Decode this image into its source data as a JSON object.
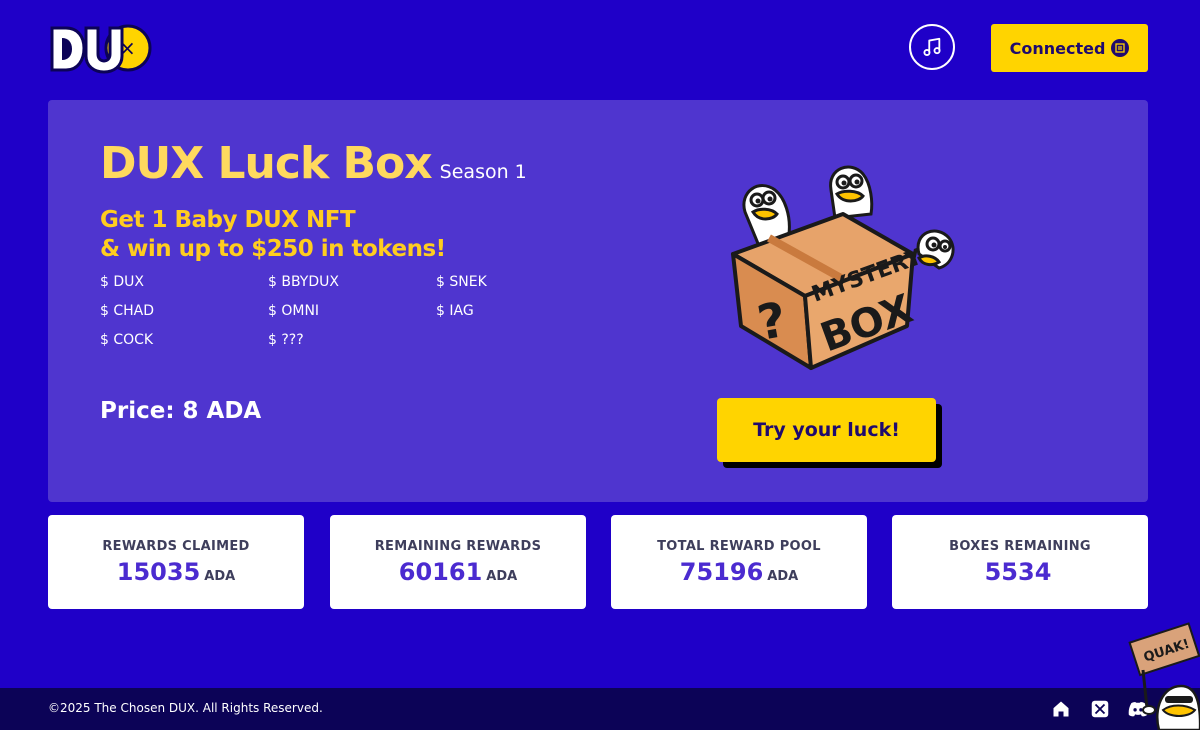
{
  "header": {
    "logo_text": "DUX",
    "connect_label": "Connected",
    "music_icon": "music-note-icon",
    "wallet_icon": "wallet-icon"
  },
  "hero": {
    "title": "DUX Luck Box",
    "season": "Season 1",
    "promo_line1": "Get 1 Baby DUX NFT",
    "promo_line2": "& win up to $250 in tokens!",
    "tokens": [
      "$ DUX",
      "$ BBYDUX",
      "$ SNEK",
      "$ CHAD",
      "$ OMNI",
      "$ IAG",
      "$ COCK",
      "$ ???"
    ],
    "price": "Price: 8 ADA",
    "mystery_label_1": "MYSTERY",
    "mystery_label_2": "BOX",
    "cta_label": "Try your luck!"
  },
  "stats": [
    {
      "label": "REWARDS CLAIMED",
      "value": "15035",
      "unit": "ADA"
    },
    {
      "label": "REMAINING REWARDS",
      "value": "60161",
      "unit": "ADA"
    },
    {
      "label": "TOTAL REWARD POOL",
      "value": "75196",
      "unit": "ADA"
    },
    {
      "label": "BOXES REMAINING",
      "value": "5534",
      "unit": ""
    }
  ],
  "footer": {
    "copyright": "©2025 The Chosen DUX. All Rights Reserved.",
    "icons": [
      "home-icon",
      "x-icon",
      "discord-icon"
    ]
  },
  "mascot": {
    "sign_text": "QUAK!"
  },
  "colors": {
    "background": "#1f00c8",
    "panel": "#4f35cf",
    "accent_yellow": "#ffd400",
    "title_yellow": "#ffd95e",
    "stat_value": "#4b2bd0",
    "footer": "#0c0357"
  }
}
